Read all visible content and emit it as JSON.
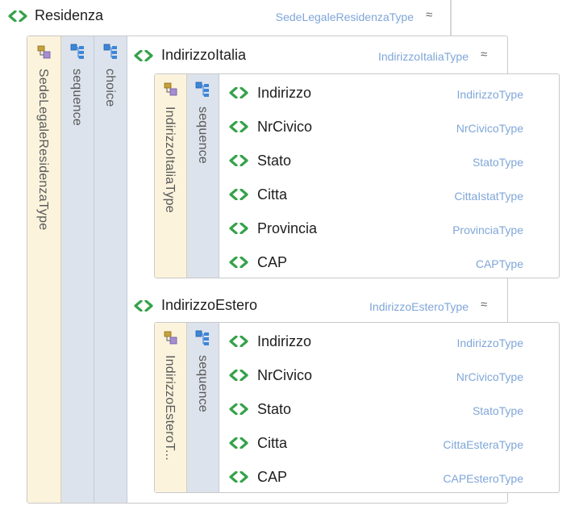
{
  "root": {
    "name": "Residenza",
    "type": "SedeLegaleResidenzaType",
    "collapse": "≈"
  },
  "outer_strips": {
    "type_label": "SedeLegaleResidenzaType",
    "sequence_label": "sequence",
    "choice_label": "choice"
  },
  "italia": {
    "name": "IndirizzoItalia",
    "type": "IndirizzoItaliaType",
    "collapse": "≈",
    "type_strip": "IndirizzoItaliaType",
    "sequence_label": "sequence",
    "elements": [
      {
        "name": "Indirizzo",
        "type": "IndirizzoType"
      },
      {
        "name": "NrCivico",
        "type": "NrCivicoType"
      },
      {
        "name": "Stato",
        "type": "StatoType"
      },
      {
        "name": "Citta",
        "type": "CittaIstatType"
      },
      {
        "name": "Provincia",
        "type": "ProvinciaType"
      },
      {
        "name": "CAP",
        "type": "CAPType"
      }
    ]
  },
  "estero": {
    "name": "IndirizzoEstero",
    "type": "IndirizzoEsteroType",
    "collapse": "≈",
    "type_strip": "IndirizzoEsteroT...",
    "sequence_label": "sequence",
    "elements": [
      {
        "name": "Indirizzo",
        "type": "IndirizzoType"
      },
      {
        "name": "NrCivico",
        "type": "NrCivicoType"
      },
      {
        "name": "Stato",
        "type": "StatoType"
      },
      {
        "name": "Citta",
        "type": "CittaEsteraType"
      },
      {
        "name": "CAP",
        "type": "CAPEsteroType"
      }
    ]
  },
  "colors": {
    "element_icon": "#35a24a",
    "type_text": "#7fa6d8",
    "type_strip_bg": "#fbf3dc",
    "sequence_strip_bg": "#dde3ec"
  },
  "icons": {
    "element": "element-icon",
    "complex_type": "complex-type-icon",
    "sequence": "sequence-icon",
    "choice": "choice-icon"
  }
}
